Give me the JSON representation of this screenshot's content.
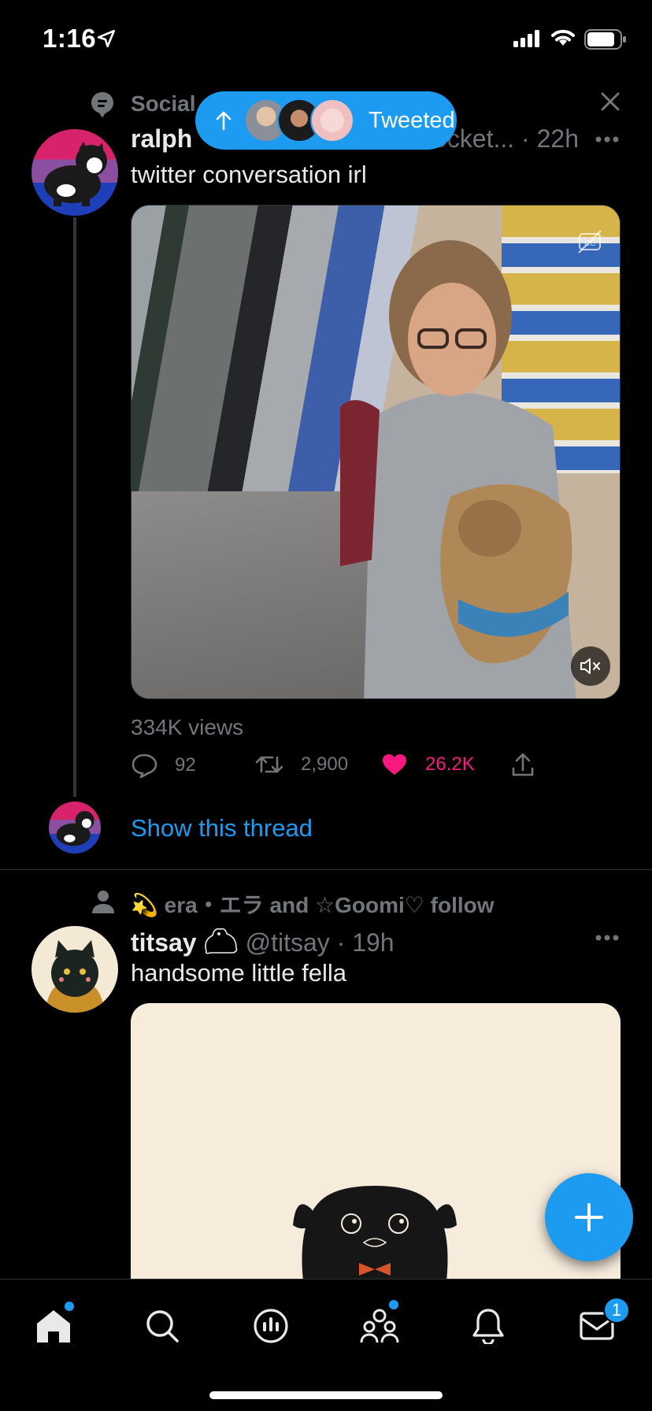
{
  "status_bar": {
    "time": "1:16"
  },
  "tweeted_pill": {
    "label": "Tweeted"
  },
  "tweet1": {
    "social_context": "Social",
    "name": "ralph",
    "handle": "ocket...",
    "time": "22h",
    "text": "twitter conversation irl",
    "views": "334K views",
    "replies": "92",
    "retweets": "2,900",
    "likes": "26.2K",
    "show_thread": "Show this thread"
  },
  "tweet2": {
    "follow_context": "💫 era・エラ and ☆Goomi♡ follow",
    "name": "titsay",
    "handle": "@titsay",
    "time": "19h",
    "text": "handsome little fella"
  },
  "tab_bar": {
    "items": [
      "home",
      "search",
      "spaces",
      "communities",
      "notifications",
      "messages"
    ],
    "messages_badge": "1"
  },
  "colors": {
    "accent": "#1d9bf0",
    "like": "#f91880",
    "muted": "#71767b",
    "background": "#000000"
  }
}
